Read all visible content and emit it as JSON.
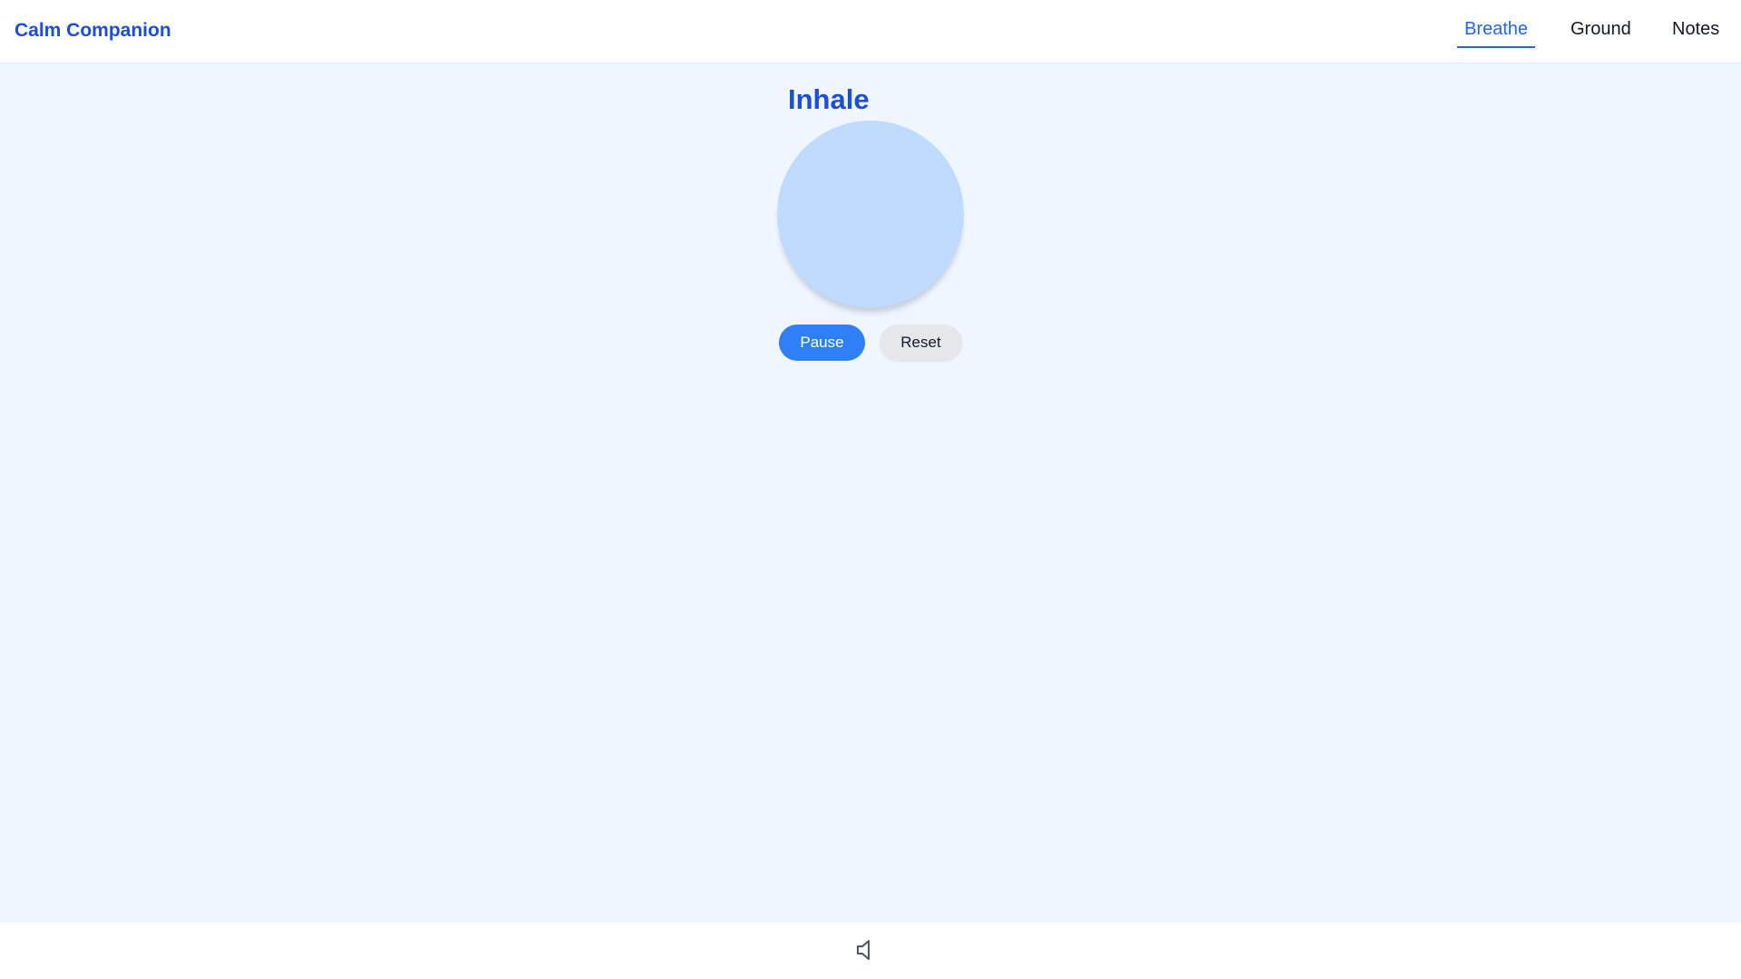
{
  "header": {
    "brand": "Calm Companion",
    "tabs": [
      {
        "label": "Breathe",
        "active": true
      },
      {
        "label": "Ground",
        "active": false
      },
      {
        "label": "Notes",
        "active": false
      }
    ]
  },
  "main": {
    "phase_label": "Inhale",
    "controls": {
      "pause_label": "Pause",
      "reset_label": "Reset"
    }
  },
  "footer": {
    "sound_icon": "speaker-muted-icon"
  },
  "colors": {
    "accent": "#2563eb",
    "brand": "#1d4ed8",
    "background": "#eff6ff",
    "circle": "#bfdbfe",
    "pause_button": "#2f80f7",
    "reset_button": "#e5e7eb"
  }
}
